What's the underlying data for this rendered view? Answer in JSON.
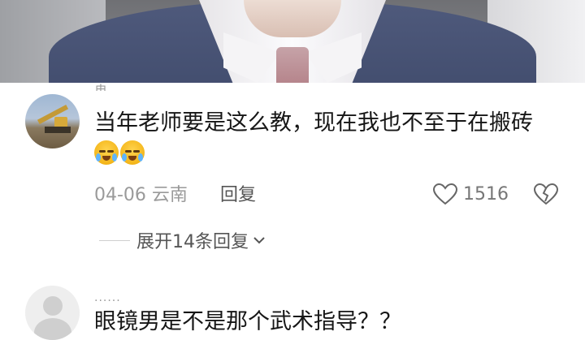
{
  "comments": [
    {
      "username": "冉...",
      "text": "当年老师要是这么教，现在我也不至于在搬砖",
      "date_location": "04-06 云南",
      "reply_label": "回复",
      "like_count": "1516",
      "expand_replies_label": "展开14条回复"
    },
    {
      "username": "......",
      "text": "眼镜男是不是那个武术指导？？"
    }
  ],
  "icons": {
    "emoji": "crying-laughing-emoji",
    "like": "heart-outline-icon",
    "dislike": "broken-heart-icon",
    "expand": "chevron-down-icon"
  },
  "colors": {
    "text": "#161616",
    "meta": "#9a9a9a",
    "action": "#555555"
  }
}
